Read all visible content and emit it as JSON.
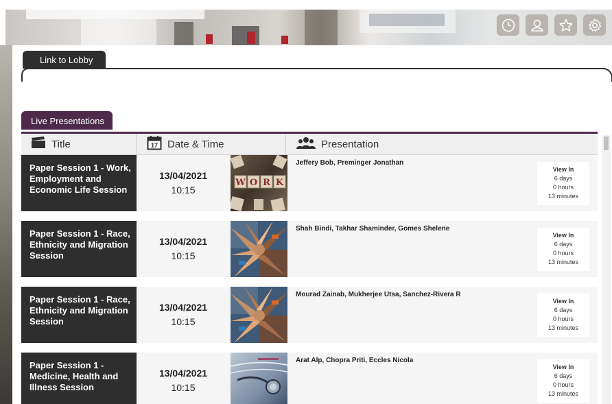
{
  "header": {
    "icons": [
      "clock-icon",
      "user-icon",
      "star-icon",
      "gear-icon"
    ]
  },
  "tabs": {
    "lobby_label": "Link to Lobby",
    "live_label": "Live Presentations"
  },
  "table": {
    "columns": {
      "title": "Title",
      "date": "Date & Time",
      "presentation": "Presentation"
    },
    "rows": [
      {
        "title": "Paper Session 1 - Work, Employment and Economic Life Session",
        "date": "13/04/2021",
        "time": "10:15",
        "presenters": "Jeffery Bob, Preminger Jonathan",
        "thumb": "work-image",
        "view_label": "View In",
        "days": "6 days",
        "hours": "0 hours",
        "minutes": "13 minutes"
      },
      {
        "title": "Paper Session 1 - Race, Ethnicity and Migration Session",
        "date": "13/04/2021",
        "time": "10:15",
        "presenters": "Shah Bindi, Takhar Shaminder, Gomes Shelene",
        "thumb": "hands-image",
        "view_label": "View In",
        "days": "6 days",
        "hours": "0 hours",
        "minutes": "13 minutes"
      },
      {
        "title": "Paper Session 1 - Race, Ethnicity and Migration Session",
        "date": "13/04/2021",
        "time": "10:15",
        "presenters": "Mourad Zainab, Mukherjee Utsa, Sanchez-Rivera R",
        "thumb": "hands-image",
        "view_label": "View In",
        "days": "6 days",
        "hours": "0 hours",
        "minutes": "13 minutes"
      },
      {
        "title": "Paper Session 1 - Medicine, Health and Illness Session",
        "date": "13/04/2021",
        "time": "10:15",
        "presenters": "Arat Alp, Chopra Priti, Eccles Nicola",
        "thumb": "stethoscope-image",
        "view_label": "View In",
        "days": "6 days",
        "hours": "0 hours",
        "minutes": "13 minutes"
      }
    ]
  },
  "work_letters": [
    "W",
    "O",
    "R",
    "K"
  ],
  "calendar_icon_day": "17",
  "colors": {
    "accent": "#4d2a4c",
    "dark": "#2e2e2e"
  }
}
